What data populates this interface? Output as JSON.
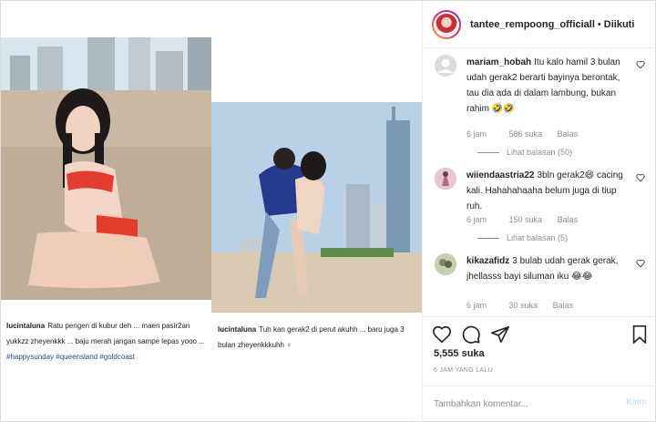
{
  "header": {
    "username": "tantee_rempoong_officiall",
    "separator": "•",
    "follow_status": "Diikuti"
  },
  "media": {
    "captions": [
      {
        "user": "lucintaluna",
        "text": "Ratu pengen di kubur deh ... maen pasir2an yukkzz zheyenkkk ... baju merah jangan sampe lepas yooo ...",
        "hashtags": "#happysunday #queensland #goldcoast"
      },
      {
        "user": "lucintaluna",
        "text": "Tuh kan gerak2 di perut akuhh ... baru juga 3 bulan zheyenkkkuhh ♀"
      }
    ]
  },
  "comments": [
    {
      "username": "mariam_hobah",
      "text": "Itu kalo hamil 3 bulan udah gerak2 berarti bayinya berontak, tau dia ada di dalam lambung, bukan rahim 🤣🤣",
      "time": "6 jam",
      "likes": "586 suka",
      "reply_label": "Balas",
      "view_replies": "Lihat balasan (50)",
      "avatar_color": "#dcdcdc"
    },
    {
      "username": "wiiendaastria22",
      "text": "3bln gerak2😄 cacing kali. Hahahahaaha belum juga di tiup ruh.",
      "time": "6 jam",
      "likes": "150 suka",
      "reply_label": "Balas",
      "view_replies": "Lihat balasan (5)",
      "avatar_color": "#c08aa2"
    },
    {
      "username": "kikazafidz",
      "text": "3 bulab udah gerak gerak, jhellasss bayi siluman iku 😂😂",
      "time": "6 jam",
      "likes": "30 suka",
      "reply_label": "Balas",
      "avatar_color": "#9aa37a"
    }
  ],
  "actions": {
    "like_icon": "heart-icon",
    "comment_icon": "comment-bubble-icon",
    "share_icon": "paper-plane-icon",
    "save_icon": "bookmark-icon",
    "like_count": "5,555 suka",
    "time_ago": "6 JAM YANG LALU"
  },
  "add_comment": {
    "placeholder": "Tambahkan komentar...",
    "post_label": "Kirim"
  },
  "colors": {
    "border": "#dbdbdb",
    "muted": "#8e8e8e",
    "post_button": "#b3dbff",
    "hashtag": "#1f4a8a"
  }
}
